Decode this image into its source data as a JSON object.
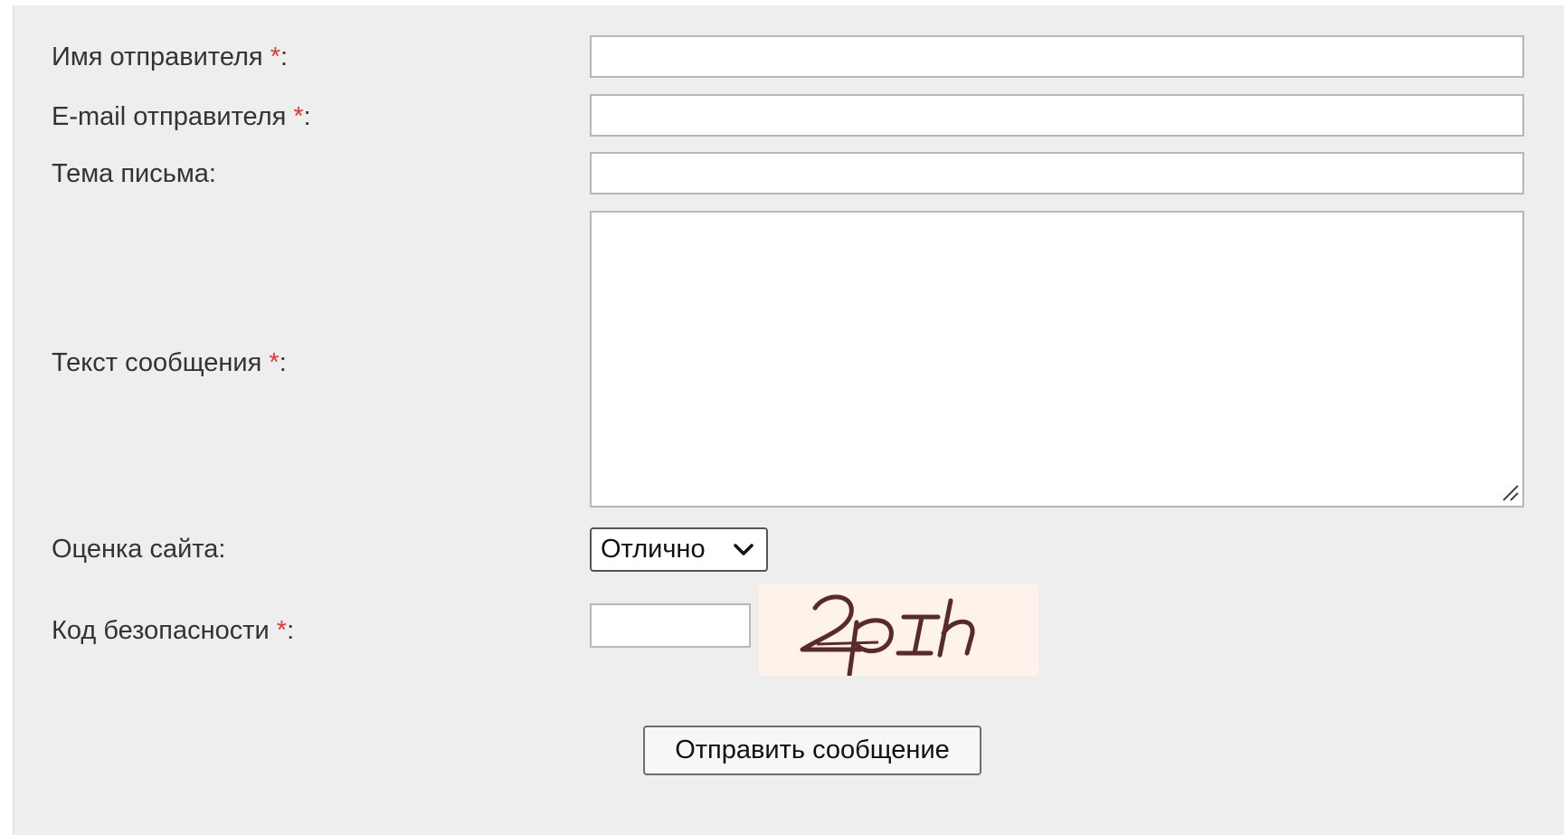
{
  "form": {
    "sender_name": {
      "label": "Имя отправителя ",
      "required_mark": "*",
      "suffix": ":",
      "value": ""
    },
    "sender_email": {
      "label": "E-mail отправителя ",
      "required_mark": "*",
      "suffix": ":",
      "value": ""
    },
    "subject": {
      "label": "Тема письма:",
      "value": ""
    },
    "message": {
      "label": "Текст сообщения ",
      "required_mark": "*",
      "suffix": ":",
      "value": ""
    },
    "rating": {
      "label": "Оценка сайта:",
      "selected": "Отлично"
    },
    "captcha": {
      "label": "Код безопасности ",
      "required_mark": "*",
      "suffix": ":",
      "value": "",
      "image_text": "2pIh"
    },
    "submit_label": "Отправить сообщение"
  },
  "colors": {
    "panel_bg": "#eeeeee",
    "required": "#e53935",
    "captcha_bg": "#fdf3ea",
    "captcha_ink": "#5a2a28"
  },
  "icons": {
    "select_arrow": "chevron-down-icon",
    "textarea_resize": "resize-grip-icon"
  }
}
